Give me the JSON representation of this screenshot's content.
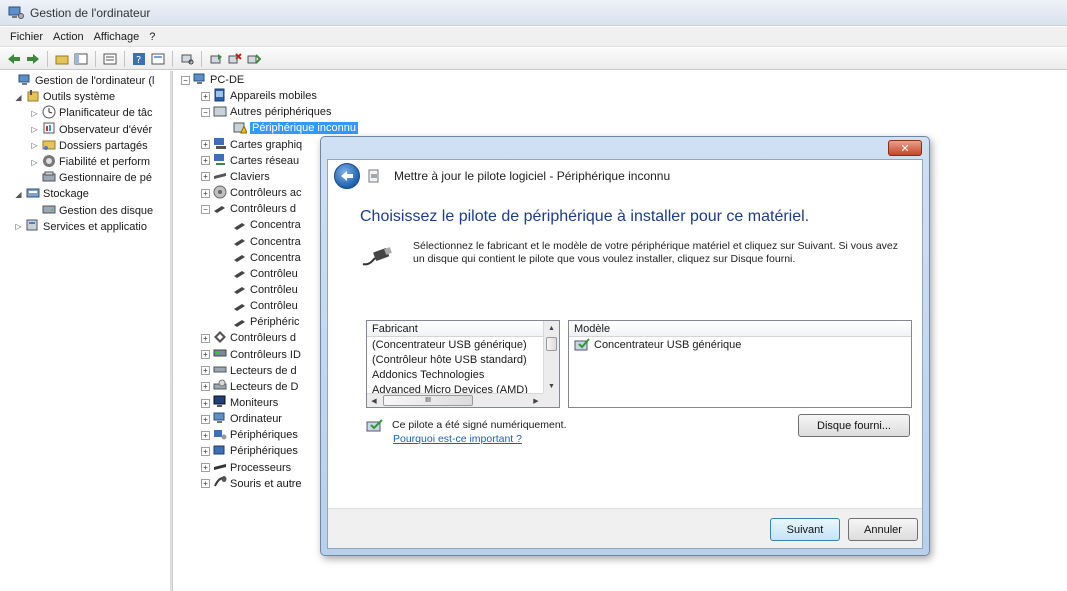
{
  "window": {
    "title": "Gestion de l'ordinateur"
  },
  "menu": [
    "Fichier",
    "Action",
    "Affichage",
    "?"
  ],
  "left_tree": [
    {
      "label": "Gestion de l'ordinateur (l",
      "icon": "computer-icon",
      "level": 0,
      "expander": ""
    },
    {
      "label": "Outils système",
      "icon": "tools-icon",
      "level": 1,
      "expander": "◢"
    },
    {
      "label": "Planificateur de tâc",
      "icon": "clock-icon",
      "level": 2,
      "expander": "▷"
    },
    {
      "label": "Observateur d'évér",
      "icon": "event-viewer-icon",
      "level": 2,
      "expander": "▷"
    },
    {
      "label": "Dossiers partagés",
      "icon": "shared-folder-icon",
      "level": 2,
      "expander": "▷"
    },
    {
      "label": "Fiabilité et perform",
      "icon": "performance-icon",
      "level": 2,
      "expander": "▷"
    },
    {
      "label": "Gestionnaire de pé",
      "icon": "device-manager-icon",
      "level": 2,
      "expander": ""
    },
    {
      "label": "Stockage",
      "icon": "storage-icon",
      "level": 1,
      "expander": "◢"
    },
    {
      "label": "Gestion des disque",
      "icon": "disk-icon",
      "level": 2,
      "expander": ""
    },
    {
      "label": "Services et applicatio",
      "icon": "services-icon",
      "level": 1,
      "expander": "▷"
    }
  ],
  "device_tree": [
    {
      "label": "PC-DE",
      "icon": "computer-icon",
      "level": 0,
      "box": "−"
    },
    {
      "label": "Appareils mobiles",
      "icon": "mobile-device-icon",
      "level": 1,
      "box": "+"
    },
    {
      "label": "Autres périphériques",
      "icon": "unknown-devices-icon",
      "level": 1,
      "box": "−"
    },
    {
      "label": "Périphérique inconnu",
      "icon": "warning-device-icon",
      "level": 2,
      "box": "",
      "selected": true
    },
    {
      "label": "Cartes graphiq",
      "icon": "display-adapter-icon",
      "level": 1,
      "box": "+"
    },
    {
      "label": "Cartes réseau",
      "icon": "network-adapter-icon",
      "level": 1,
      "box": "+"
    },
    {
      "label": "Claviers",
      "icon": "keyboard-icon",
      "level": 1,
      "box": "+"
    },
    {
      "label": "Contrôleurs ac",
      "icon": "audio-controller-icon",
      "level": 1,
      "box": "+"
    },
    {
      "label": "Contrôleurs d",
      "icon": "usb-controller-icon",
      "level": 1,
      "box": "−"
    },
    {
      "label": "Concentra",
      "icon": "usb-plug-icon",
      "level": 2,
      "box": ""
    },
    {
      "label": "Concentra",
      "icon": "usb-plug-icon",
      "level": 2,
      "box": ""
    },
    {
      "label": "Concentra",
      "icon": "usb-plug-icon",
      "level": 2,
      "box": ""
    },
    {
      "label": "Contrôleu",
      "icon": "usb-plug-icon",
      "level": 2,
      "box": ""
    },
    {
      "label": "Contrôleu",
      "icon": "usb-plug-icon",
      "level": 2,
      "box": ""
    },
    {
      "label": "Contrôleu",
      "icon": "usb-plug-icon",
      "level": 2,
      "box": ""
    },
    {
      "label": "Périphéric",
      "icon": "usb-plug-icon",
      "level": 2,
      "box": ""
    },
    {
      "label": "Contrôleurs d",
      "icon": "storage-controller-icon",
      "level": 1,
      "box": "+"
    },
    {
      "label": "Contrôleurs ID",
      "icon": "ide-controller-icon",
      "level": 1,
      "box": "+"
    },
    {
      "label": "Lecteurs de d",
      "icon": "disk-drive-icon",
      "level": 1,
      "box": "+"
    },
    {
      "label": "Lecteurs de D",
      "icon": "dvd-drive-icon",
      "level": 1,
      "box": "+"
    },
    {
      "label": "Moniteurs",
      "icon": "monitor-icon",
      "level": 1,
      "box": "+"
    },
    {
      "label": "Ordinateur",
      "icon": "computer-icon",
      "level": 1,
      "box": "+"
    },
    {
      "label": "Périphériques",
      "icon": "hid-device-icon",
      "level": 1,
      "box": "+"
    },
    {
      "label": "Périphériques",
      "icon": "system-device-icon",
      "level": 1,
      "box": "+"
    },
    {
      "label": "Processeurs",
      "icon": "processor-icon",
      "level": 1,
      "box": "+"
    },
    {
      "label": "Souris et autre",
      "icon": "mouse-icon",
      "level": 1,
      "box": "+"
    }
  ],
  "dialog": {
    "close_label": "✕",
    "window_title": "Mettre à jour le pilote logiciel - Périphérique inconnu",
    "heading": "Choisissez le pilote de périphérique à installer pour ce matériel.",
    "description": "Sélectionnez le fabricant et le modèle de votre périphérique matériel et cliquez sur Suivant. Si vous avez un disque qui contient le pilote que vous voulez installer, cliquez sur Disque fourni.",
    "manufacturer_header": "Fabricant",
    "manufacturers": [
      "(Concentrateur USB générique)",
      "(Contrôleur hôte USB standard)",
      "Addonics Technologies",
      "Advanced Micro Devices (AMD)"
    ],
    "model_header": "Modèle",
    "models": [
      "Concentrateur USB générique"
    ],
    "hscroll_thumb_label": "III",
    "signed_text": "Ce pilote a été signé numériquement.",
    "why_link": "Pourquoi est-ce important ?",
    "have_disk_button": "Disque fourni...",
    "next_button": "Suivant",
    "cancel_button": "Annuler"
  }
}
